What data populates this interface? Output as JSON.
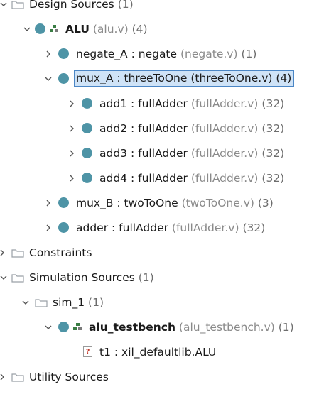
{
  "tree": {
    "design_sources": {
      "label": "Design Sources",
      "count": "(1)"
    },
    "alu": {
      "name": "ALU",
      "file": "(alu.v)",
      "count": "(4)"
    },
    "negate_a": {
      "name": "negate_A : negate",
      "file": "(negate.v)",
      "count": "(1)"
    },
    "mux_a": {
      "name": "mux_A : threeToOne",
      "file": "(threeToOne.v)",
      "count": "(4)"
    },
    "add1": {
      "name": "add1 : fullAdder",
      "file": "(fullAdder.v)",
      "count": "(32)"
    },
    "add2": {
      "name": "add2 : fullAdder",
      "file": "(fullAdder.v)",
      "count": "(32)"
    },
    "add3": {
      "name": "add3 : fullAdder",
      "file": "(fullAdder.v)",
      "count": "(32)"
    },
    "add4": {
      "name": "add4 : fullAdder",
      "file": "(fullAdder.v)",
      "count": "(32)"
    },
    "mux_b": {
      "name": "mux_B : twoToOne",
      "file": "(twoToOne.v)",
      "count": "(3)"
    },
    "adder": {
      "name": "adder : fullAdder",
      "file": "(fullAdder.v)",
      "count": "(32)"
    },
    "constraints": {
      "label": "Constraints"
    },
    "simulation_sources": {
      "label": "Simulation Sources",
      "count": "(1)"
    },
    "sim_1": {
      "label": "sim_1",
      "count": "(1)"
    },
    "alu_testbench": {
      "name": "alu_testbench",
      "file": "(alu_testbench.v)",
      "count": "(1)"
    },
    "t1": {
      "name": "t1 : xil_defaultlib.ALU",
      "icon_glyph": "?"
    },
    "utility_sources": {
      "label": "Utility Sources"
    }
  },
  "colors": {
    "dot": "#4e94a6",
    "selection_bg": "#cfe3f7",
    "selection_border": "#4b86c5",
    "meta_text": "#8a8a8a"
  },
  "icons": [
    "chevron-down-icon",
    "chevron-right-icon",
    "folder-icon",
    "module-dot-icon",
    "hierarchy-icon",
    "unknown-file-icon"
  ]
}
